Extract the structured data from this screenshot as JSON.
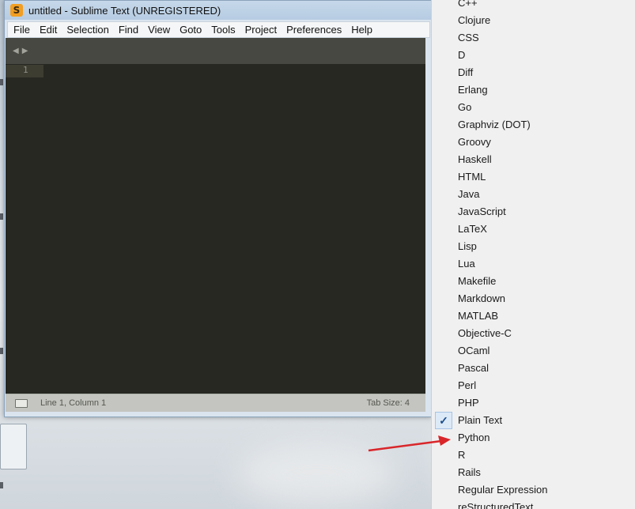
{
  "window": {
    "title": "untitled - Sublime Text (UNREGISTERED)",
    "app_icon_glyph": "S"
  },
  "menubar": [
    "File",
    "Edit",
    "Selection",
    "Find",
    "View",
    "Goto",
    "Tools",
    "Project",
    "Preferences",
    "Help"
  ],
  "editor": {
    "line_numbers": [
      "1"
    ],
    "background_color": "#272822"
  },
  "statusbar": {
    "position": "Line 1, Column 1",
    "tab_size": "Tab Size: 4"
  },
  "syntax_menu": {
    "items": [
      {
        "label": "C++",
        "checked": false
      },
      {
        "label": "Clojure",
        "checked": false
      },
      {
        "label": "CSS",
        "checked": false
      },
      {
        "label": "D",
        "checked": false
      },
      {
        "label": "Diff",
        "checked": false
      },
      {
        "label": "Erlang",
        "checked": false
      },
      {
        "label": "Go",
        "checked": false
      },
      {
        "label": "Graphviz (DOT)",
        "checked": false
      },
      {
        "label": "Groovy",
        "checked": false
      },
      {
        "label": "Haskell",
        "checked": false
      },
      {
        "label": "HTML",
        "checked": false
      },
      {
        "label": "Java",
        "checked": false
      },
      {
        "label": "JavaScript",
        "checked": false
      },
      {
        "label": "LaTeX",
        "checked": false
      },
      {
        "label": "Lisp",
        "checked": false
      },
      {
        "label": "Lua",
        "checked": false
      },
      {
        "label": "Makefile",
        "checked": false
      },
      {
        "label": "Markdown",
        "checked": false
      },
      {
        "label": "MATLAB",
        "checked": false
      },
      {
        "label": "Objective-C",
        "checked": false
      },
      {
        "label": "OCaml",
        "checked": false
      },
      {
        "label": "Pascal",
        "checked": false
      },
      {
        "label": "Perl",
        "checked": false
      },
      {
        "label": "PHP",
        "checked": false
      },
      {
        "label": "Plain Text",
        "checked": true
      },
      {
        "label": "Python",
        "checked": false
      },
      {
        "label": "R",
        "checked": false
      },
      {
        "label": "Rails",
        "checked": false
      },
      {
        "label": "Regular Expression",
        "checked": false
      },
      {
        "label": "reStructuredText",
        "checked": false
      }
    ],
    "check_glyph": "✓"
  },
  "annotation": {
    "arrow_color": "#d9262a",
    "points_to": "Python"
  }
}
